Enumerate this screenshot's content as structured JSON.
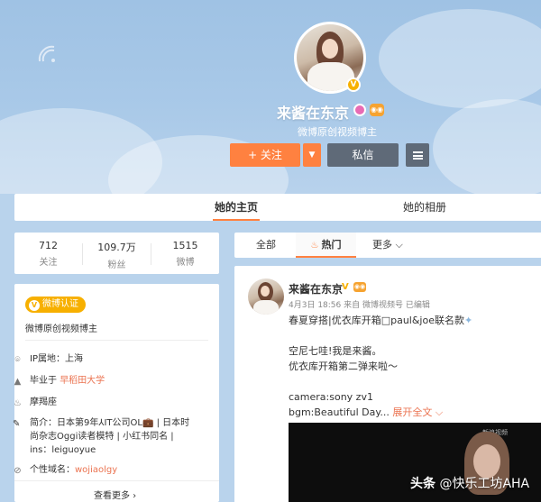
{
  "profile": {
    "name": "来酱在东京",
    "description": "微博原创视频博主",
    "follow_label": "+ 关注",
    "follow_dropdown_label": "▼",
    "message_label": "私信"
  },
  "nav_tabs": {
    "home": "她的主页",
    "album": "她的相册"
  },
  "stats": [
    {
      "value": "712",
      "label": "关注"
    },
    {
      "value": "109.7万",
      "label": "粉丝"
    },
    {
      "value": "1515",
      "label": "微博"
    }
  ],
  "info": {
    "verify_badge": "微博认证",
    "verify_desc": "微博原创视频博主",
    "ip_location": "IP属地：上海",
    "education_prefix": "毕业于 ",
    "education_school": "早稻田大学",
    "zodiac": "摩羯座",
    "bio": "简介：日本第9年⅄IT公司OL💼 | 日本时尚杂志Oggi读者模特 | 小红书同名 | ins：leiguoyue",
    "domain_prefix": "个性域名：",
    "domain_value": "wojiaolgy",
    "view_more": "查看更多 ›"
  },
  "feed_tabs": {
    "all": "全部",
    "hot": "热门",
    "more": "更多 ⌵"
  },
  "post": {
    "author": "来酱在东京",
    "meta": "4月3日 18:56 来自 微博视频号  已编辑",
    "line1": "春夏穿搭|优衣库开箱□paul&joe联名款",
    "line1_sparkle": "✦",
    "line2": "空尼七哇!我是来酱。",
    "line3": "优衣库开箱第二弹来啦～",
    "line4": "camera:sony zv1",
    "line5": "bgm:Beautiful Day...",
    "expand": "展开全文 ⌵"
  },
  "video": {
    "watermark_small": "新浪视频"
  },
  "watermark": {
    "brand": "头条",
    "text": " @快乐工坊AHA"
  },
  "colors": {
    "accent": "#ff8140",
    "dark_button": "#5f6a78",
    "verify": "#f7b000",
    "link": "#eb7350"
  }
}
